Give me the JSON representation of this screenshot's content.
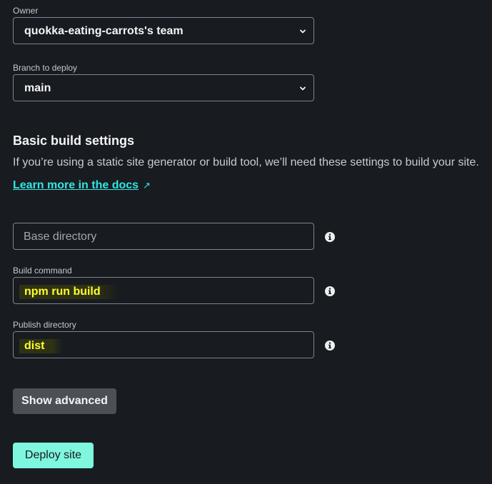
{
  "owner": {
    "label": "Owner",
    "value": "quokka-eating-carrots's team"
  },
  "branch": {
    "label": "Branch to deploy",
    "value": "main"
  },
  "build_settings": {
    "title": "Basic build settings",
    "description": "If you’re using a static site generator or build tool, we’ll need these settings to build your site.",
    "docs_link": "Learn more in the docs",
    "docs_link_icon": "↗"
  },
  "base_directory": {
    "placeholder": "Base directory",
    "value": ""
  },
  "build_command": {
    "label": "Build command",
    "value": "npm run build"
  },
  "publish_directory": {
    "label": "Publish directory",
    "value": "dist"
  },
  "buttons": {
    "show_advanced": "Show advanced",
    "deploy": "Deploy site"
  },
  "colors": {
    "background": "#181b20",
    "link": "#32e6e2",
    "deploy_button": "#7ff6de",
    "highlight_text": "#ffff2e"
  },
  "icons": {
    "select_chevron": "chevron-down-icon",
    "field_info": "info-icon",
    "external_link": "arrow-up-right-icon"
  }
}
